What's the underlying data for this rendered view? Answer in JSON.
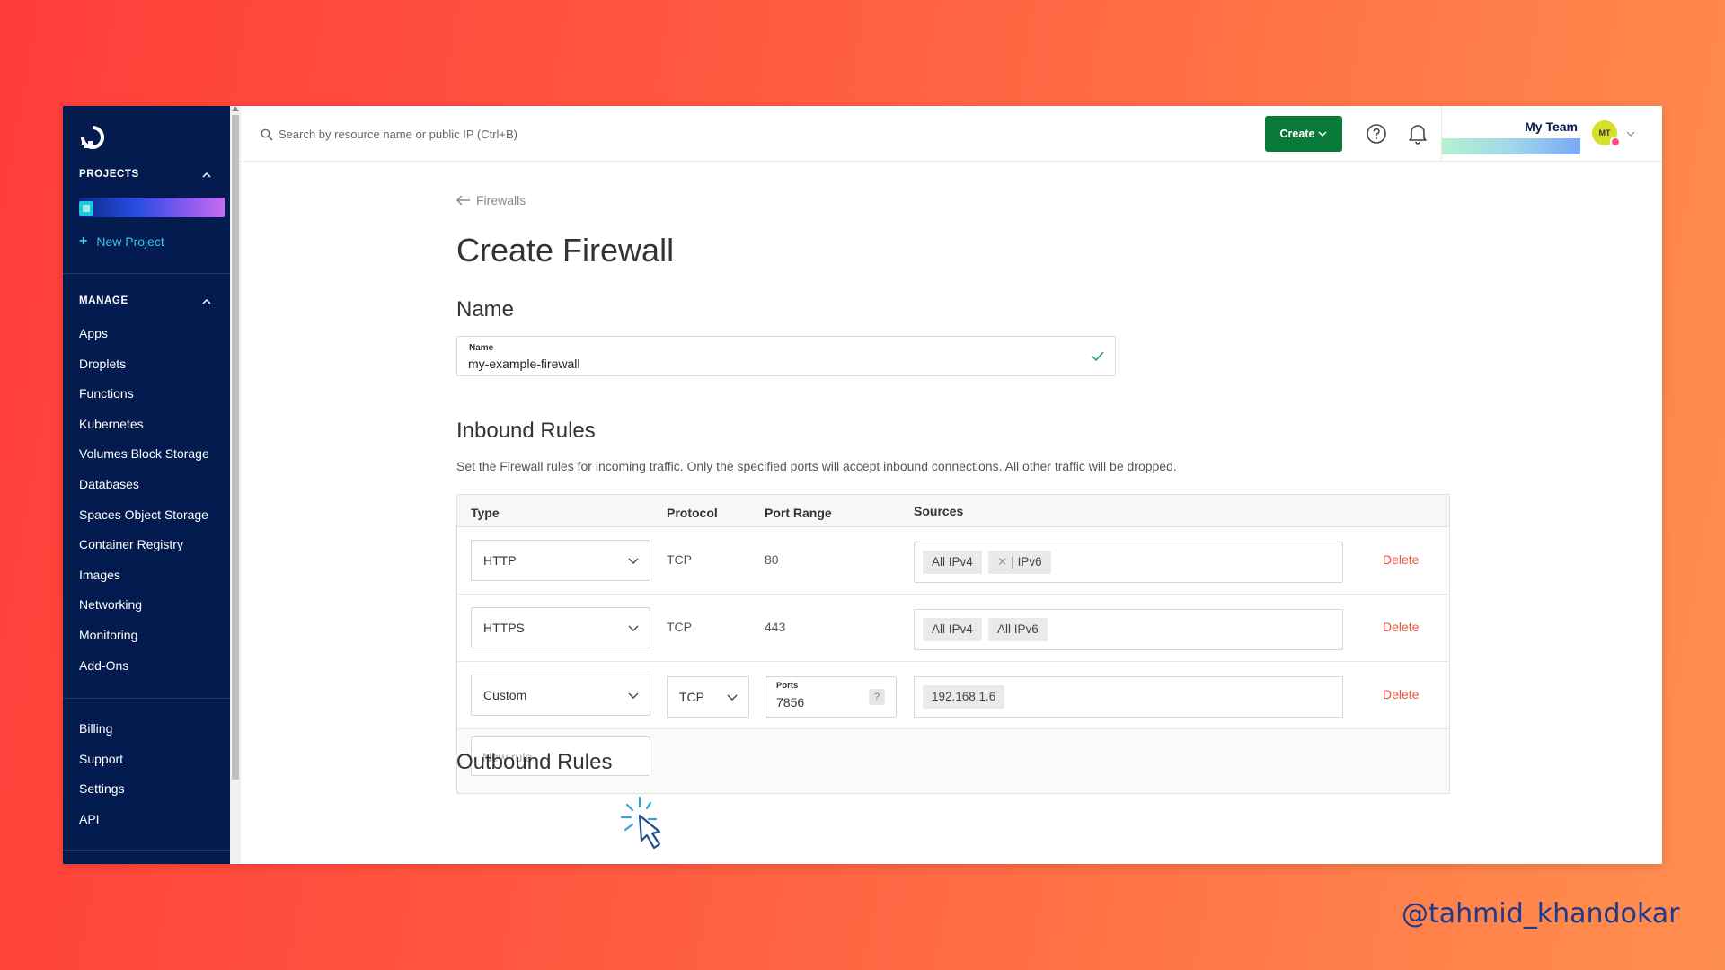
{
  "sidebar": {
    "projects_heading": "PROJECTS",
    "new_project_label": "New Project",
    "manage_heading": "MANAGE",
    "manage_items": [
      {
        "label": "Apps"
      },
      {
        "label": "Droplets"
      },
      {
        "label": "Functions"
      },
      {
        "label": "Kubernetes"
      },
      {
        "label": "Volumes Block Storage"
      },
      {
        "label": "Databases"
      },
      {
        "label": "Spaces Object Storage"
      },
      {
        "label": "Container Registry"
      },
      {
        "label": "Images"
      },
      {
        "label": "Networking"
      },
      {
        "label": "Monitoring"
      },
      {
        "label": "Add-Ons"
      }
    ],
    "account_items": [
      {
        "label": "Billing"
      },
      {
        "label": "Support"
      },
      {
        "label": "Settings"
      },
      {
        "label": "API"
      }
    ]
  },
  "topbar": {
    "search_placeholder": "Search by resource name or public IP (Ctrl+B)",
    "create_label": "Create",
    "team_name": "My Team",
    "avatar_initials": "MT"
  },
  "page": {
    "breadcrumb": "Firewalls",
    "title": "Create Firewall",
    "name_section": "Name",
    "name_field_label": "Name",
    "name_value": "my-example-firewall",
    "inbound_title": "Inbound Rules",
    "inbound_description": "Set the Firewall rules for incoming traffic. Only the specified ports will accept inbound connections. All other traffic will be dropped.",
    "outbound_title": "Outbound Rules"
  },
  "rules": {
    "headers": {
      "type": "Type",
      "protocol": "Protocol",
      "port_range": "Port Range",
      "sources": "Sources"
    },
    "rows": [
      {
        "type": "HTTP",
        "protocol": "TCP",
        "port_range": "80",
        "sources": [
          "All IPv4",
          "IPv6"
        ],
        "delete": "Delete"
      },
      {
        "type": "HTTPS",
        "protocol": "TCP",
        "port_range": "443",
        "sources": [
          "All IPv4",
          "All IPv6"
        ],
        "delete": "Delete"
      },
      {
        "type": "Custom",
        "protocol": "TCP",
        "ports_label": "Ports",
        "port_range": "7856",
        "ports_help": "?",
        "sources": [
          "192.168.1.6"
        ],
        "delete": "Delete"
      }
    ],
    "new_rule_placeholder": "New rule"
  },
  "watermark": "@tahmid_khandokar",
  "colors": {
    "sidebar_bg": "#031b4e",
    "create_button": "#0a7a3a",
    "delete_link": "#e8543a",
    "accent_link": "#3cc3e8"
  }
}
